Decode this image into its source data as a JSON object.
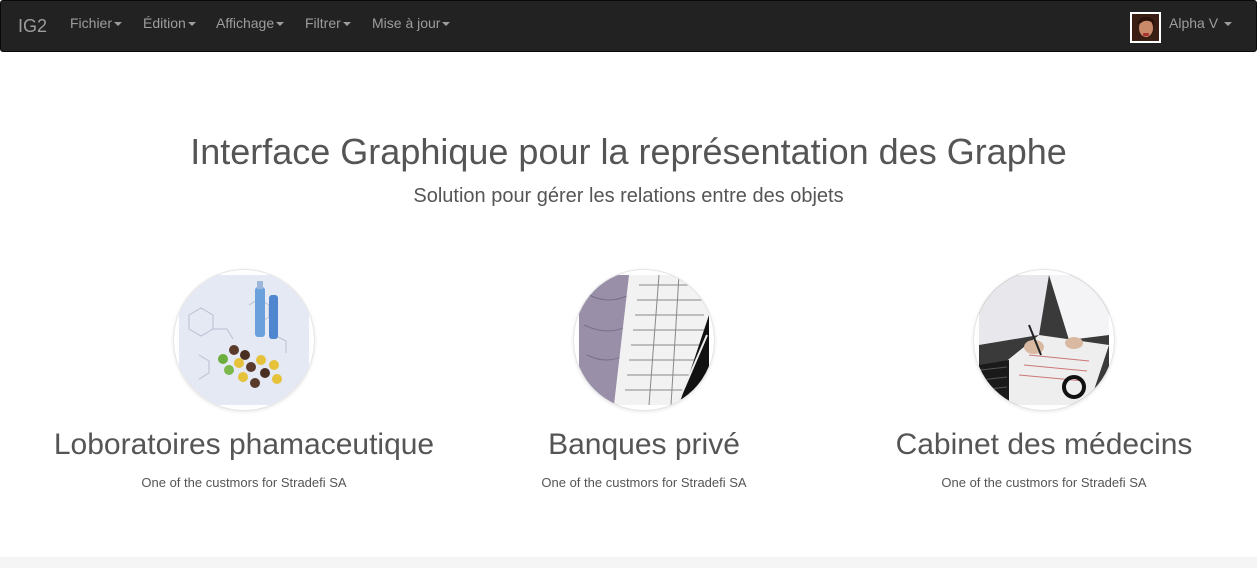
{
  "navbar": {
    "brand": "IG2",
    "menu": [
      {
        "label": "Fichier"
      },
      {
        "label": "Édition"
      },
      {
        "label": "Affichage"
      },
      {
        "label": "Filtrer"
      },
      {
        "label": "Mise à jour"
      }
    ],
    "user": {
      "name": "Alpha V"
    }
  },
  "hero": {
    "title": "Interface Graphique pour la représentation des Graphe",
    "subtitle": "Solution pour gérer les relations entre des objets"
  },
  "features": [
    {
      "title": "Loboratoires phamaceutique",
      "description": "One of the custmors for Stradefi SA",
      "image": "pharmaceutical-image"
    },
    {
      "title": "Banques privé",
      "description": "One of the custmors for Stradefi SA",
      "image": "banking-image"
    },
    {
      "title": "Cabinet des médecins",
      "description": "One of the custmors for Stradefi SA",
      "image": "doctor-image"
    }
  ],
  "colors": {
    "navbar_bg": "#222222",
    "nav_text": "#9d9d9d",
    "body_text": "#555555",
    "footer_band": "#f5f5f5"
  }
}
